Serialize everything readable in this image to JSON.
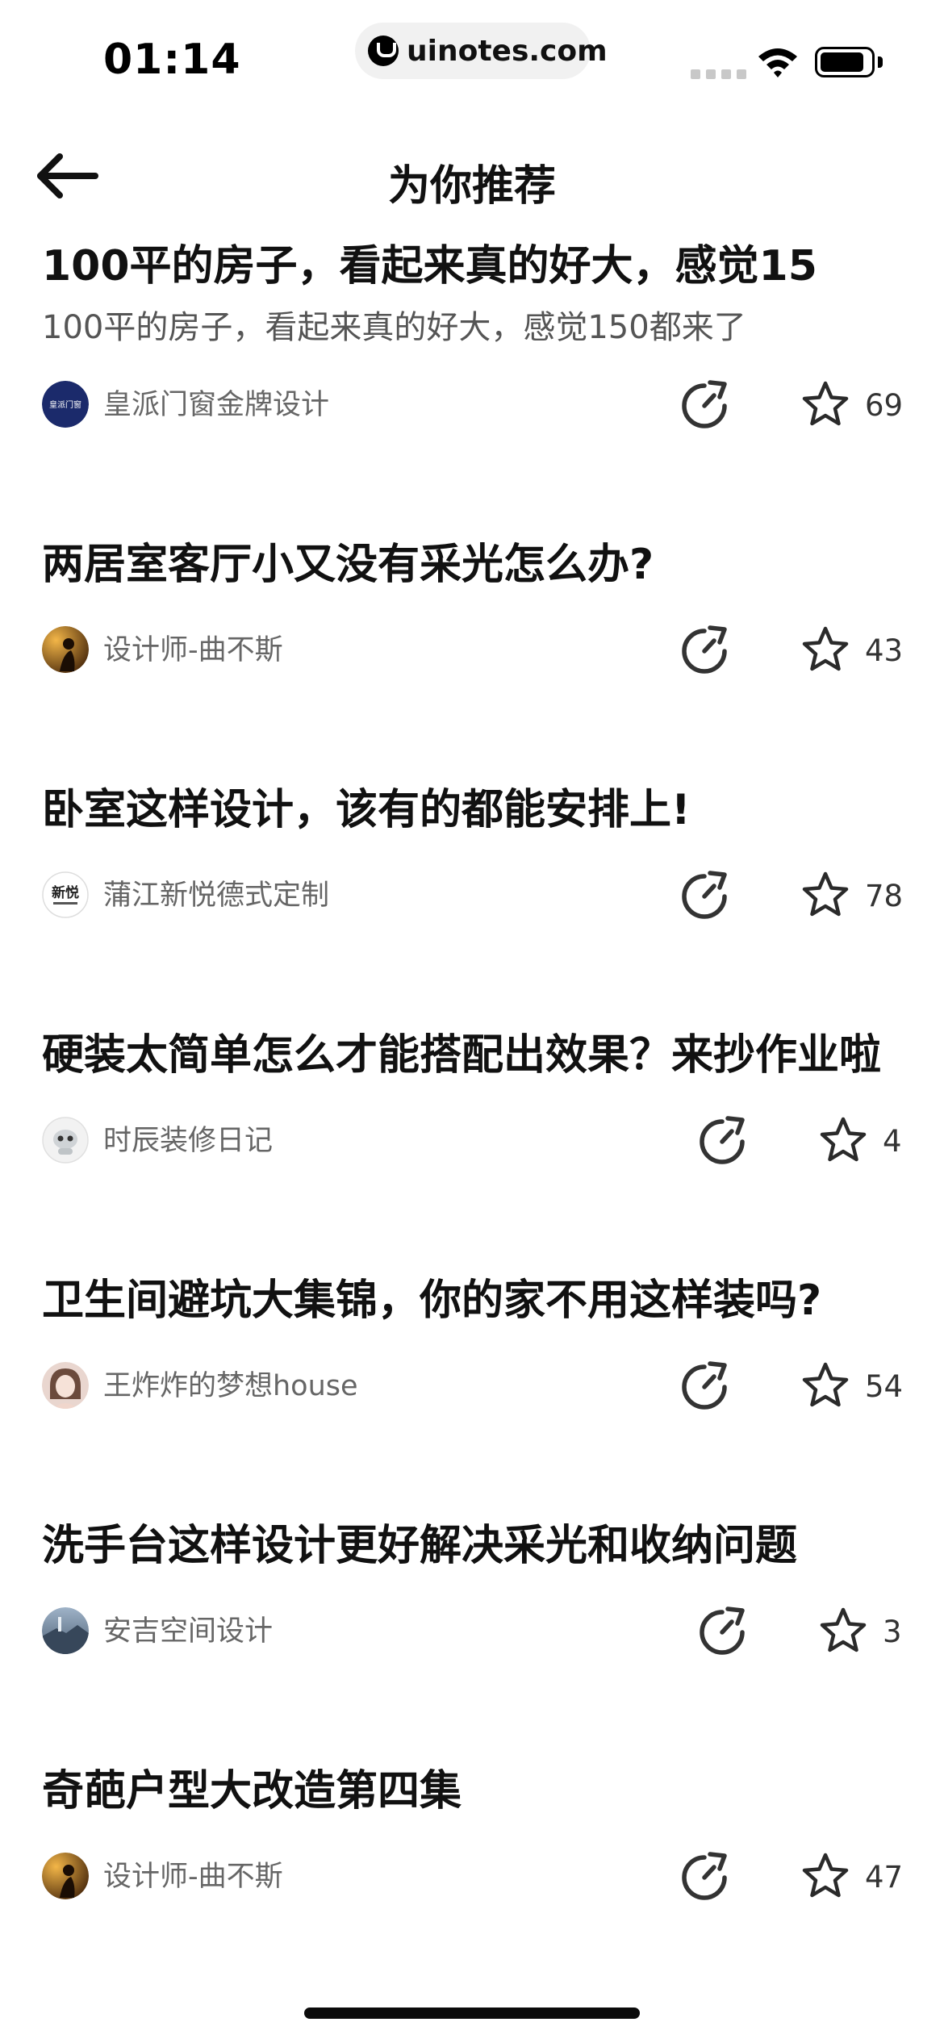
{
  "status_bar": {
    "time": "01:14",
    "url": "uinotes.com"
  },
  "nav": {
    "title": "为你推荐",
    "back_icon": "arrow-left-icon"
  },
  "icons": {
    "refresh": "refresh-arrow-icon",
    "like": "star-icon"
  },
  "feed": [
    {
      "title": "100平的房子，看起来真的好大，感觉15",
      "subtitle": "100平的房子，看起来真的好大，感觉150都来了",
      "author": "皇派门窗金牌设计",
      "avatar_text": "皇派门窗",
      "avatar_style": "navy",
      "likes": "69"
    },
    {
      "title": "两居室客厅小又没有采光怎么办?",
      "subtitle": "",
      "author": "设计师-曲不斯",
      "avatar_text": "",
      "avatar_style": "amber",
      "likes": "43"
    },
    {
      "title": "卧室这样设计，该有的都能安排上!",
      "subtitle": "",
      "author": "蒲江新悦德式定制",
      "avatar_text": "新悦",
      "avatar_style": "white-logo",
      "likes": "78"
    },
    {
      "title": "硬装太简单怎么才能搭配出效果？来抄作业啦",
      "subtitle": "",
      "author": "时辰装修日记",
      "avatar_text": "",
      "avatar_style": "robot",
      "likes": "4"
    },
    {
      "title": "卫生间避坑大集锦，你的家不用这样装吗?",
      "subtitle": "",
      "author": "王炸炸的梦想house",
      "avatar_text": "",
      "avatar_style": "portrait",
      "likes": "54"
    },
    {
      "title": "洗手台这样设计更好解决采光和收纳问题",
      "subtitle": "",
      "author": "安吉空间设计",
      "avatar_text": "",
      "avatar_style": "landscape",
      "likes": "3"
    },
    {
      "title": "奇葩户型大改造第四集",
      "subtitle": "",
      "author": "设计师-曲不斯",
      "avatar_text": "",
      "avatar_style": "amber",
      "likes": "47"
    }
  ]
}
